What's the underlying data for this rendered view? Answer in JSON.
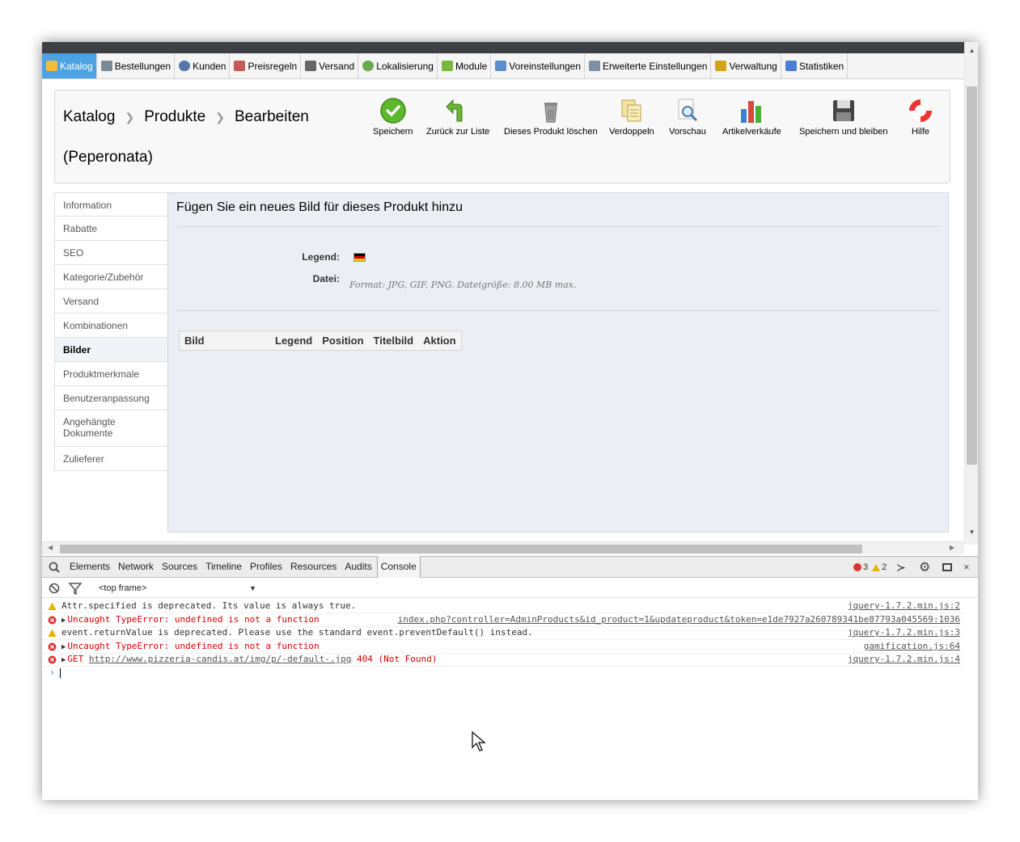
{
  "nav": {
    "items": [
      {
        "label": "Katalog",
        "color": "#f4b942"
      },
      {
        "label": "Bestellungen",
        "color": "#7a8a99"
      },
      {
        "label": "Kunden",
        "color": "#5577aa"
      },
      {
        "label": "Preisregeln",
        "color": "#c55a5a"
      },
      {
        "label": "Versand",
        "color": "#666666"
      },
      {
        "label": "Lokalisierung",
        "color": "#6aa84f"
      },
      {
        "label": "Module",
        "color": "#78b83c"
      },
      {
        "label": "Voreinstellungen",
        "color": "#5b8fc7"
      },
      {
        "label": "Erweiterte Einstellungen",
        "color": "#7e8ea3"
      },
      {
        "label": "Verwaltung",
        "color": "#d4a418"
      },
      {
        "label": "Statistiken",
        "color": "#4a7fd4"
      }
    ]
  },
  "toolbar": {
    "breadcrumb": [
      "Katalog",
      "Produkte",
      "Bearbeiten"
    ],
    "product_title": "(Peperonata)",
    "buttons": {
      "save": "Speichern",
      "back": "Zurück zur Liste",
      "delete": "Dieses Produkt löschen",
      "duplicate": "Verdoppeln",
      "preview": "Vorschau",
      "sales": "Artikelverkäufe",
      "save_stay": "Speichern und bleiben",
      "help": "Hilfe"
    }
  },
  "tabs": [
    "Information",
    "Rabatte",
    "SEO",
    "Kategorie/Zubehör",
    "Versand",
    "Kombinationen",
    "Bilder",
    "Produktmerkmale",
    "Benutzeranpassung",
    "Angehängte Dokumente",
    "Zulieferer"
  ],
  "panel": {
    "title": "Fügen Sie ein neues Bild für dieses Produkt hinzu",
    "legend_label": "Legend:",
    "file_label": "Datei:",
    "format_hint": "Format: JPG, GIF, PNG. Dateigröße: 8.00 MB max.",
    "table_headers": [
      "Bild",
      "Legend",
      "Position",
      "Titelbild",
      "Aktion"
    ]
  },
  "devtools": {
    "tabs": [
      "Elements",
      "Network",
      "Sources",
      "Timeline",
      "Profiles",
      "Resources",
      "Audits",
      "Console"
    ],
    "error_count": "3",
    "warning_count": "2",
    "frame": "<top frame>",
    "lines": [
      {
        "type": "warn",
        "msg": "Attr.specified is deprecated. Its value is always true.",
        "src": "jquery-1.7.2.min.js:2"
      },
      {
        "type": "err",
        "msg": "Uncaught TypeError: undefined is not a function",
        "src": "index.php?controller=AdminProducts&id_product=1&updateproduct&token=e1de7927a260789341be87793a045569:1036"
      },
      {
        "type": "warn",
        "msg": "event.returnValue is deprecated. Please use the standard event.preventDefault() instead.",
        "src": "jquery-1.7.2.min.js:3"
      },
      {
        "type": "err",
        "msg": "Uncaught TypeError: undefined is not a function",
        "src": "gamification.js:64"
      },
      {
        "type": "err",
        "msg_prefix": "GET ",
        "url": "http://www.pizzeria-candis.at/img/p/-default-.jpg",
        "msg_suffix": " 404 (Not Found)",
        "src": "jquery-1.7.2.min.js:4"
      }
    ]
  }
}
